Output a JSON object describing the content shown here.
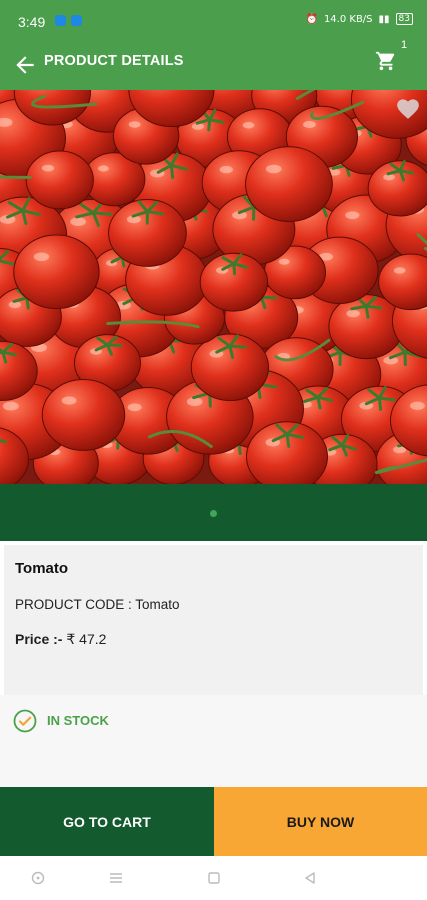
{
  "status_bar": {
    "time": "3:49",
    "right_text": "14.0 KB/S",
    "battery": "83"
  },
  "app_bar": {
    "title": "PRODUCT DETAILS",
    "cart_count": "1"
  },
  "image_carousel": {
    "page_count": 1,
    "active_page": 1
  },
  "product": {
    "name": "Tomato",
    "code_label": "PRODUCT CODE : ",
    "code_value": "Tomato",
    "price_label": "Price :-",
    "price_value": "₹ 47.2",
    "stock_status": "IN STOCK"
  },
  "actions": {
    "go_to_cart": "GO TO CART",
    "buy_now": "BUY NOW"
  },
  "colors": {
    "header_green": "#4b9e4b",
    "dark_green": "#135a2f",
    "orange": "#f8a634",
    "stock_green": "#4aa14a",
    "check_orange": "#f3a73a"
  },
  "icons": [
    "back-arrow-icon",
    "cart-icon",
    "heart-icon",
    "check-circle-icon",
    "home-icon",
    "menu-icon",
    "square-icon",
    "back-triangle-icon"
  ]
}
